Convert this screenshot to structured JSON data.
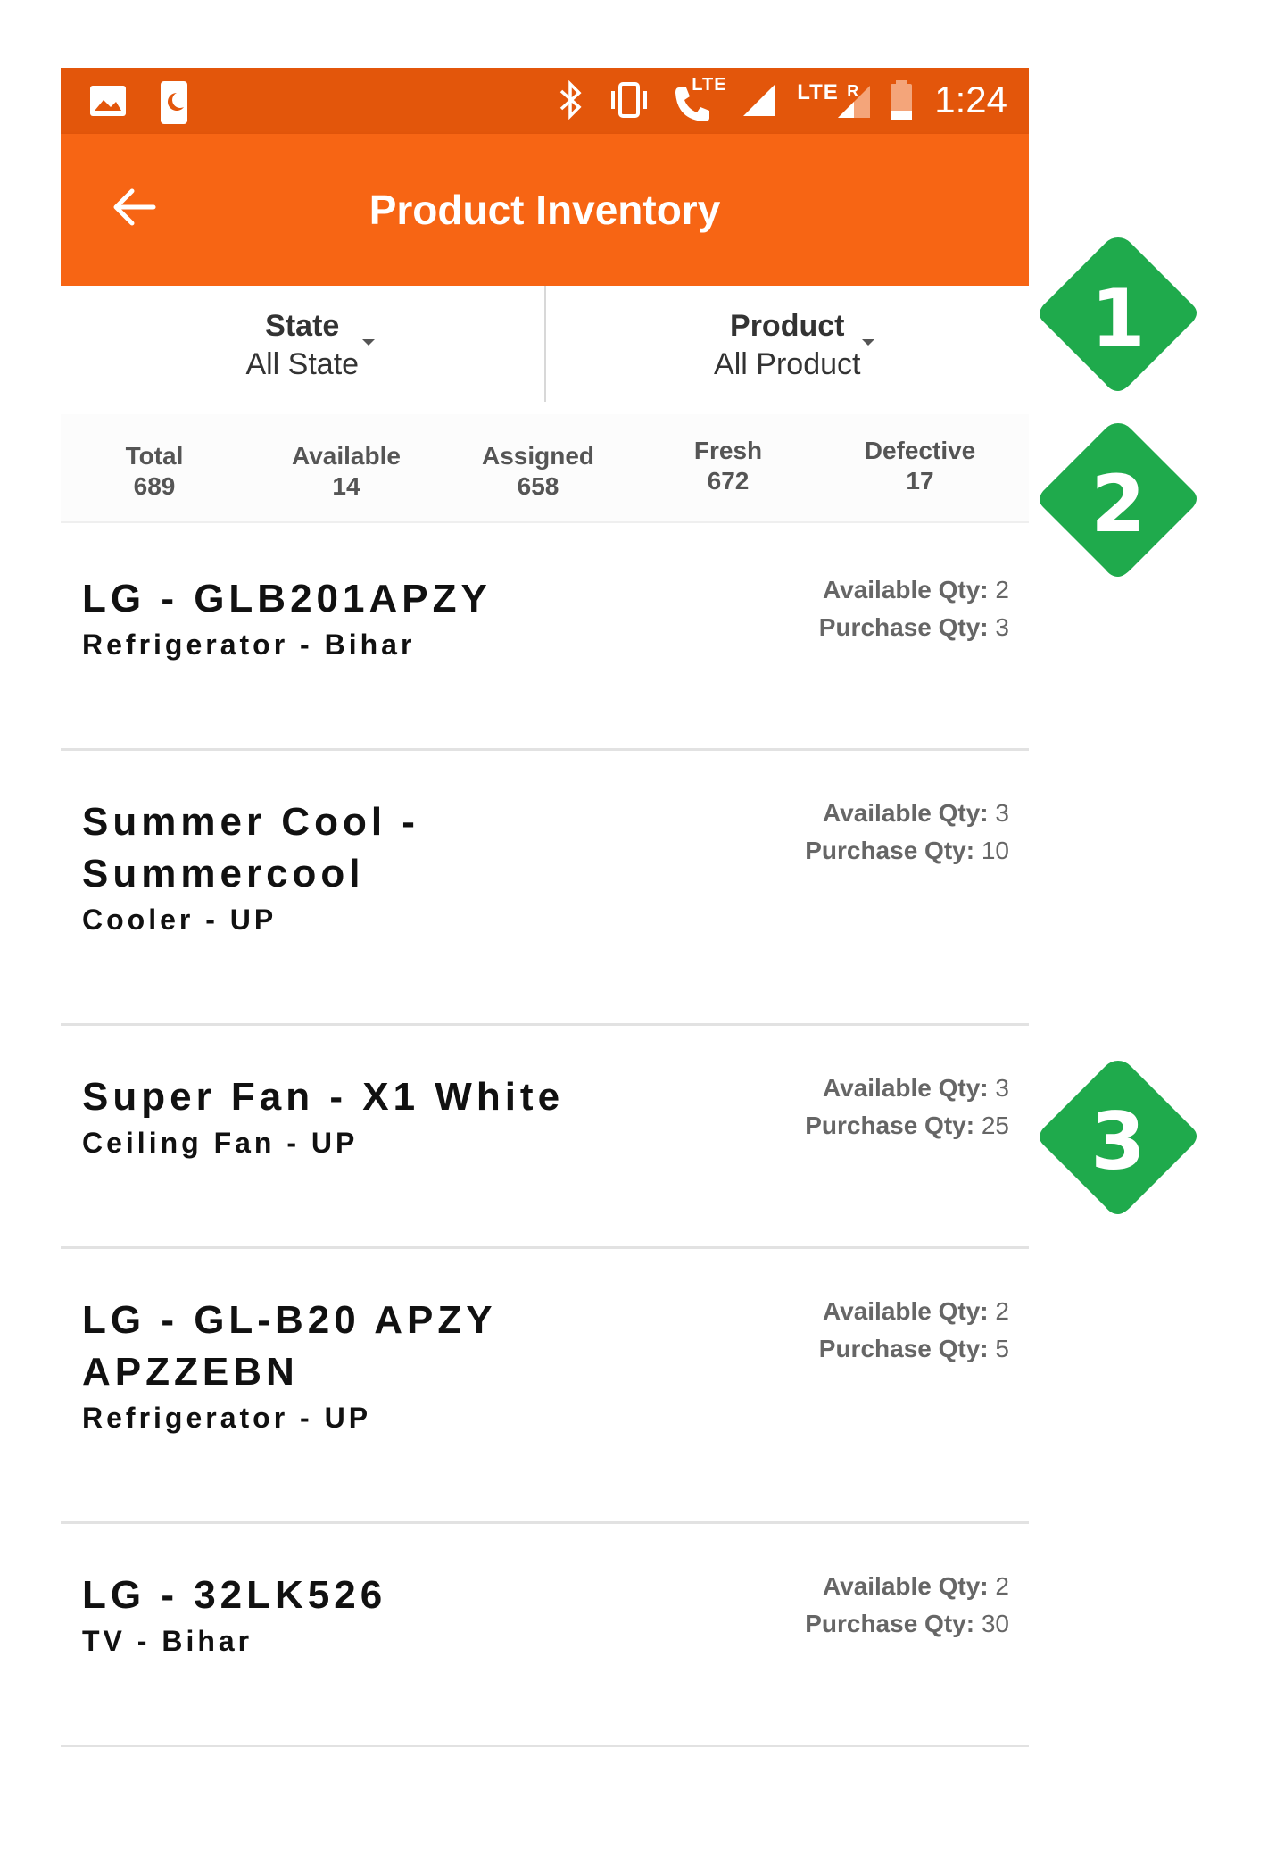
{
  "status_bar": {
    "time": "1:24",
    "lte1": "LTE",
    "lte2": "LTE",
    "roaming": "R"
  },
  "toolbar": {
    "title": "Product Inventory"
  },
  "filters": [
    {
      "label": "State",
      "value": "All State"
    },
    {
      "label": "Product",
      "value": "All Product"
    }
  ],
  "summary": [
    {
      "label": "Total",
      "value": "689"
    },
    {
      "label": "Available",
      "value": "14"
    },
    {
      "label": "Assigned",
      "value": "658"
    },
    {
      "label": "Fresh",
      "value": "672"
    },
    {
      "label": "Defective",
      "value": "17"
    }
  ],
  "qty_labels": {
    "available": "Available Qty:",
    "purchase": "Purchase Qty:"
  },
  "items": [
    {
      "title": "LG - GLB201APZY",
      "subtitle": "Refrigerator - Bihar",
      "available": "2",
      "purchase": "3"
    },
    {
      "title": "Summer Cool - Summercool",
      "subtitle": "Cooler - UP",
      "available": "3",
      "purchase": "10"
    },
    {
      "title": "Super Fan - X1 White",
      "subtitle": "Ceiling Fan - UP",
      "available": "3",
      "purchase": "25"
    },
    {
      "title": "LG - GL-B20 APZY APZZEBN",
      "subtitle": "Refrigerator - UP",
      "available": "2",
      "purchase": "5"
    },
    {
      "title": "LG - 32LK526",
      "subtitle": "TV - Bihar",
      "available": "2",
      "purchase": "30"
    }
  ],
  "callouts": [
    "1",
    "2",
    "3"
  ],
  "colors": {
    "status_bar": "#e3560b",
    "toolbar": "#f76514",
    "callout": "#1faa4c"
  }
}
